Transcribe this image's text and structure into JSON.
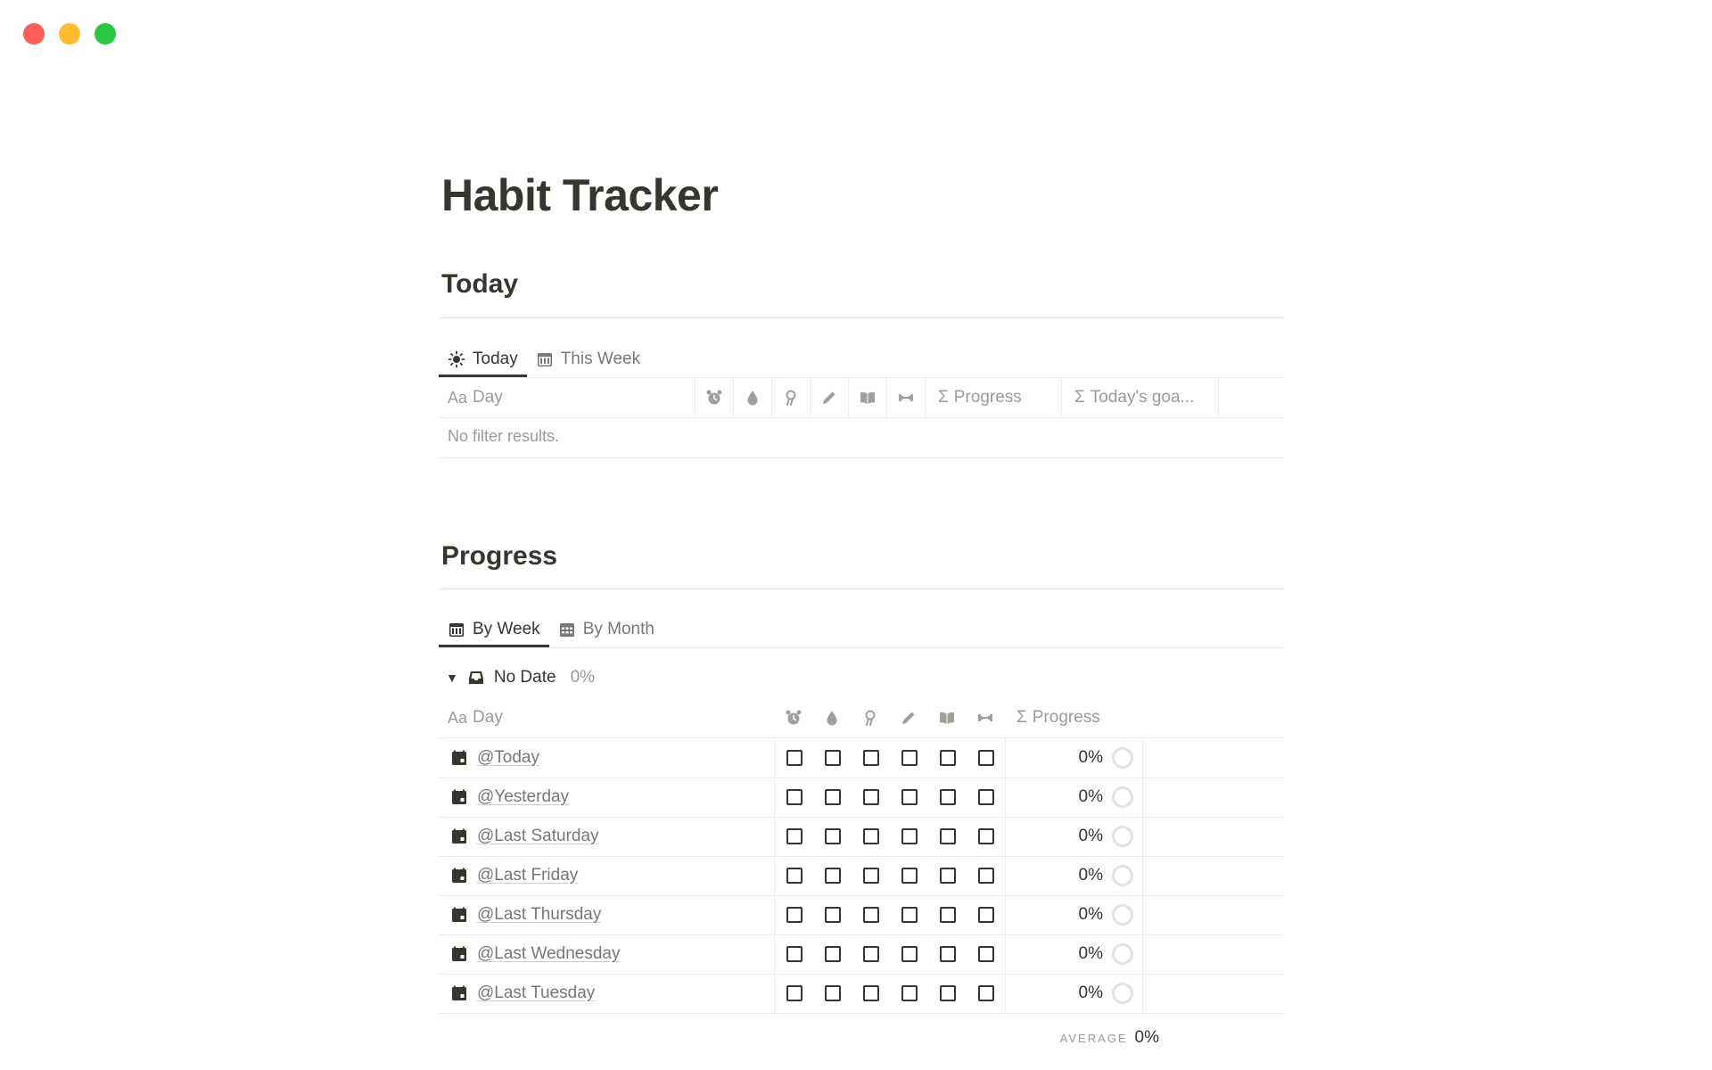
{
  "window": {
    "controls": [
      "close",
      "minimize",
      "zoom"
    ]
  },
  "page": {
    "title": "Habit Tracker"
  },
  "today_section": {
    "heading": "Today",
    "tabs": [
      {
        "label": "Today",
        "icon": "sun-icon",
        "active": true
      },
      {
        "label": "This Week",
        "icon": "calendar-icon",
        "active": false
      }
    ],
    "columns": {
      "day": "Day",
      "day_prefix": "Aa",
      "habit_icons": [
        "alarm-clock-icon",
        "water-drop-icon",
        "meditation-icon",
        "pencil-icon",
        "book-icon",
        "dumbbell-icon"
      ],
      "progress": "Progress",
      "todays_goal": "Today's goa..."
    },
    "empty_text": "No filter results."
  },
  "progress_section": {
    "heading": "Progress",
    "tabs": [
      {
        "label": "By Week",
        "icon": "calendar-icon",
        "active": true
      },
      {
        "label": "By Month",
        "icon": "calendar-grid-icon",
        "active": false
      }
    ],
    "group": {
      "name": "No Date",
      "percent": "0%",
      "icon": "inbox-icon"
    },
    "columns": {
      "day": "Day",
      "day_prefix": "Aa",
      "habit_icons": [
        "alarm-clock-icon",
        "water-drop-icon",
        "meditation-icon",
        "pencil-icon",
        "book-icon",
        "dumbbell-icon"
      ],
      "progress": "Progress"
    },
    "rows": [
      {
        "day": "@Today",
        "progress": "0%"
      },
      {
        "day": "@Yesterday",
        "progress": "0%"
      },
      {
        "day": "@Last Saturday",
        "progress": "0%"
      },
      {
        "day": "@Last Friday",
        "progress": "0%"
      },
      {
        "day": "@Last Thursday",
        "progress": "0%"
      },
      {
        "day": "@Last Wednesday",
        "progress": "0%"
      },
      {
        "day": "@Last Tuesday",
        "progress": "0%"
      }
    ],
    "footer": {
      "label": "AVERAGE",
      "value": "0%"
    }
  },
  "colors": {
    "text": "#37352f",
    "muted": "#9b9a97",
    "border": "#e3e2e0"
  }
}
